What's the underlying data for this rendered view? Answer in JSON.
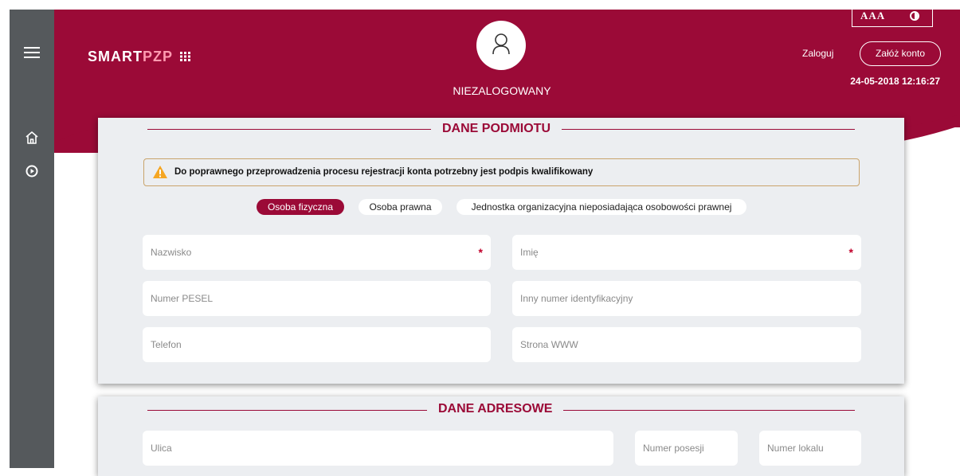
{
  "header": {
    "logo_smart": "SMART",
    "logo_pzp": "PZP",
    "user_status": "NIEZALOGOWANY",
    "accessibility_font_label": "AAA",
    "login_label": "Zaloguj",
    "register_label": "Załóż konto",
    "datetime": "24-05-2018 12:16:27"
  },
  "sidebar": {
    "icons": [
      "menu-icon",
      "home-icon",
      "play-circle-icon"
    ]
  },
  "entity_section": {
    "title": "DANE PODMIOTU",
    "warning_text": "Do poprawnego przeprowadzenia procesu rejestracji konta potrzebny jest podpis kwalifikowany",
    "entity_types": [
      "Osoba fizyczna",
      "Osoba prawna",
      "Jednostka organizacyjna nieposiadająca osobowości prawnej"
    ],
    "active_entity_type": "Osoba fizyczna",
    "fields": {
      "surname": {
        "placeholder": "Nazwisko",
        "required_mark": "*"
      },
      "first_name": {
        "placeholder": "Imię",
        "required_mark": "*"
      },
      "pesel": {
        "placeholder": "Numer PESEL"
      },
      "other_id": {
        "placeholder": "Inny numer identyfikacyjny"
      },
      "phone": {
        "placeholder": "Telefon"
      },
      "website": {
        "placeholder": "Strona WWW"
      }
    }
  },
  "address_section": {
    "title": "DANE ADRESOWE",
    "fields": {
      "street": {
        "placeholder": "Ulica"
      },
      "building_number": {
        "placeholder": "Numer posesji"
      },
      "unit_number": {
        "placeholder": "Numer lokalu"
      }
    }
  },
  "colors": {
    "brand": "#9b0a37",
    "sidebar": "#55595c",
    "card_bg": "#eceef1",
    "warning_border": "#c9a36b",
    "required": "#c1002b"
  }
}
